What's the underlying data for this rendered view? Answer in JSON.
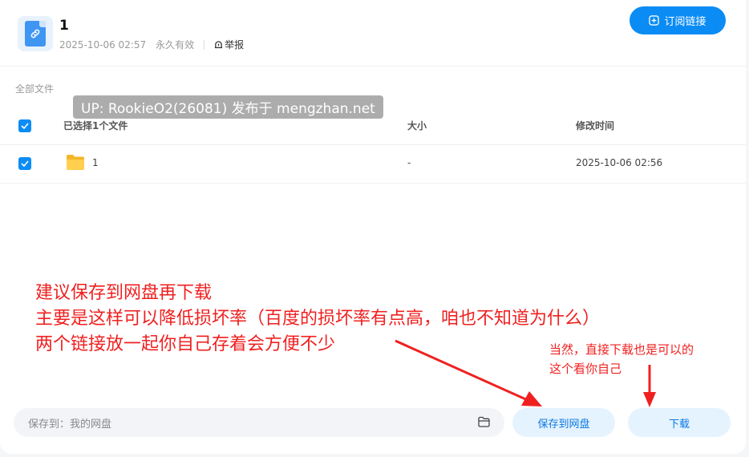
{
  "header": {
    "title": "1",
    "date": "2025-10-06 02:57",
    "validity": "永久有效",
    "report_label": "举报",
    "subscribe_label": "订阅链接"
  },
  "breadcrumb": "全部文件",
  "watermark": "UP: RookieO2(26081) 发布于 mengzhan.net",
  "table": {
    "columns": [
      "已选择1个文件",
      "大小",
      "修改时间"
    ],
    "rows": [
      {
        "name": "1",
        "size": "-",
        "modified": "2025-10-06 02:56"
      }
    ]
  },
  "annotations": {
    "big_lines": [
      "建议保存到网盘再下载",
      "主要是这样可以降低损坏率（百度的损坏率有点高，咱也不知道为什么）",
      "两个链接放一起你自己存着会方便不少"
    ],
    "small_lines": [
      "当然，直接下载也是可以的",
      "这个看你自己"
    ],
    "color": "#f02020"
  },
  "bottom": {
    "save_path_prefix": "保存到：",
    "save_path_value": "我的网盘",
    "save_button": "保存到网盘",
    "download_button": "下载"
  },
  "colors": {
    "accent": "#0b8cf5",
    "button_light_bg": "#e5f3ff"
  }
}
